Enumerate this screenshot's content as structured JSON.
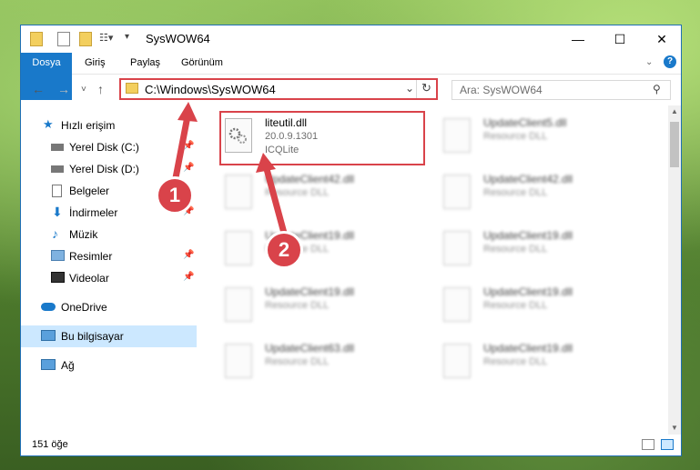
{
  "window": {
    "title": "SysWOW64"
  },
  "ribbon": {
    "tabs": [
      "Dosya",
      "Giriş",
      "Paylaş",
      "Görünüm"
    ]
  },
  "address": {
    "path": "C:\\Windows\\SysWOW64"
  },
  "search": {
    "placeholder": "Ara: SysWOW64"
  },
  "nav": {
    "items": [
      {
        "label": "Hızlı erişim"
      },
      {
        "label": "Yerel Disk (C:)"
      },
      {
        "label": "Yerel Disk (D:)"
      },
      {
        "label": "Belgeler"
      },
      {
        "label": "İndirmeler"
      },
      {
        "label": "Müzik"
      },
      {
        "label": "Resimler"
      },
      {
        "label": "Videolar"
      },
      {
        "label": "OneDrive"
      },
      {
        "label": "Bu bilgisayar"
      },
      {
        "label": "Ağ"
      }
    ]
  },
  "files": {
    "focus": {
      "name": "liteutil.dll",
      "version": "20.0.9.1301",
      "company": "ICQLite"
    },
    "blurred": [
      {
        "name": "UpdateClient5.dll",
        "type": "Resource DLL"
      },
      {
        "name": "UpdateClient42.dll",
        "type": "Resource DLL"
      },
      {
        "name": "UpdateClient42.dll",
        "type": "Resource DLL"
      },
      {
        "name": "UpdateClient19.dll",
        "type": "Resource DLL"
      },
      {
        "name": "UpdateClient19.dll",
        "type": "Resource DLL"
      },
      {
        "name": "UpdateClient19.dll",
        "type": "Resource DLL"
      },
      {
        "name": "UpdateClient19.dll",
        "type": "Resource DLL"
      },
      {
        "name": "UpdateClient63.dll",
        "type": "Resource DLL"
      },
      {
        "name": "UpdateClient19.dll",
        "type": "Resource DLL"
      }
    ]
  },
  "status": {
    "count": "151 öğe"
  },
  "callouts": [
    "1",
    "2"
  ]
}
